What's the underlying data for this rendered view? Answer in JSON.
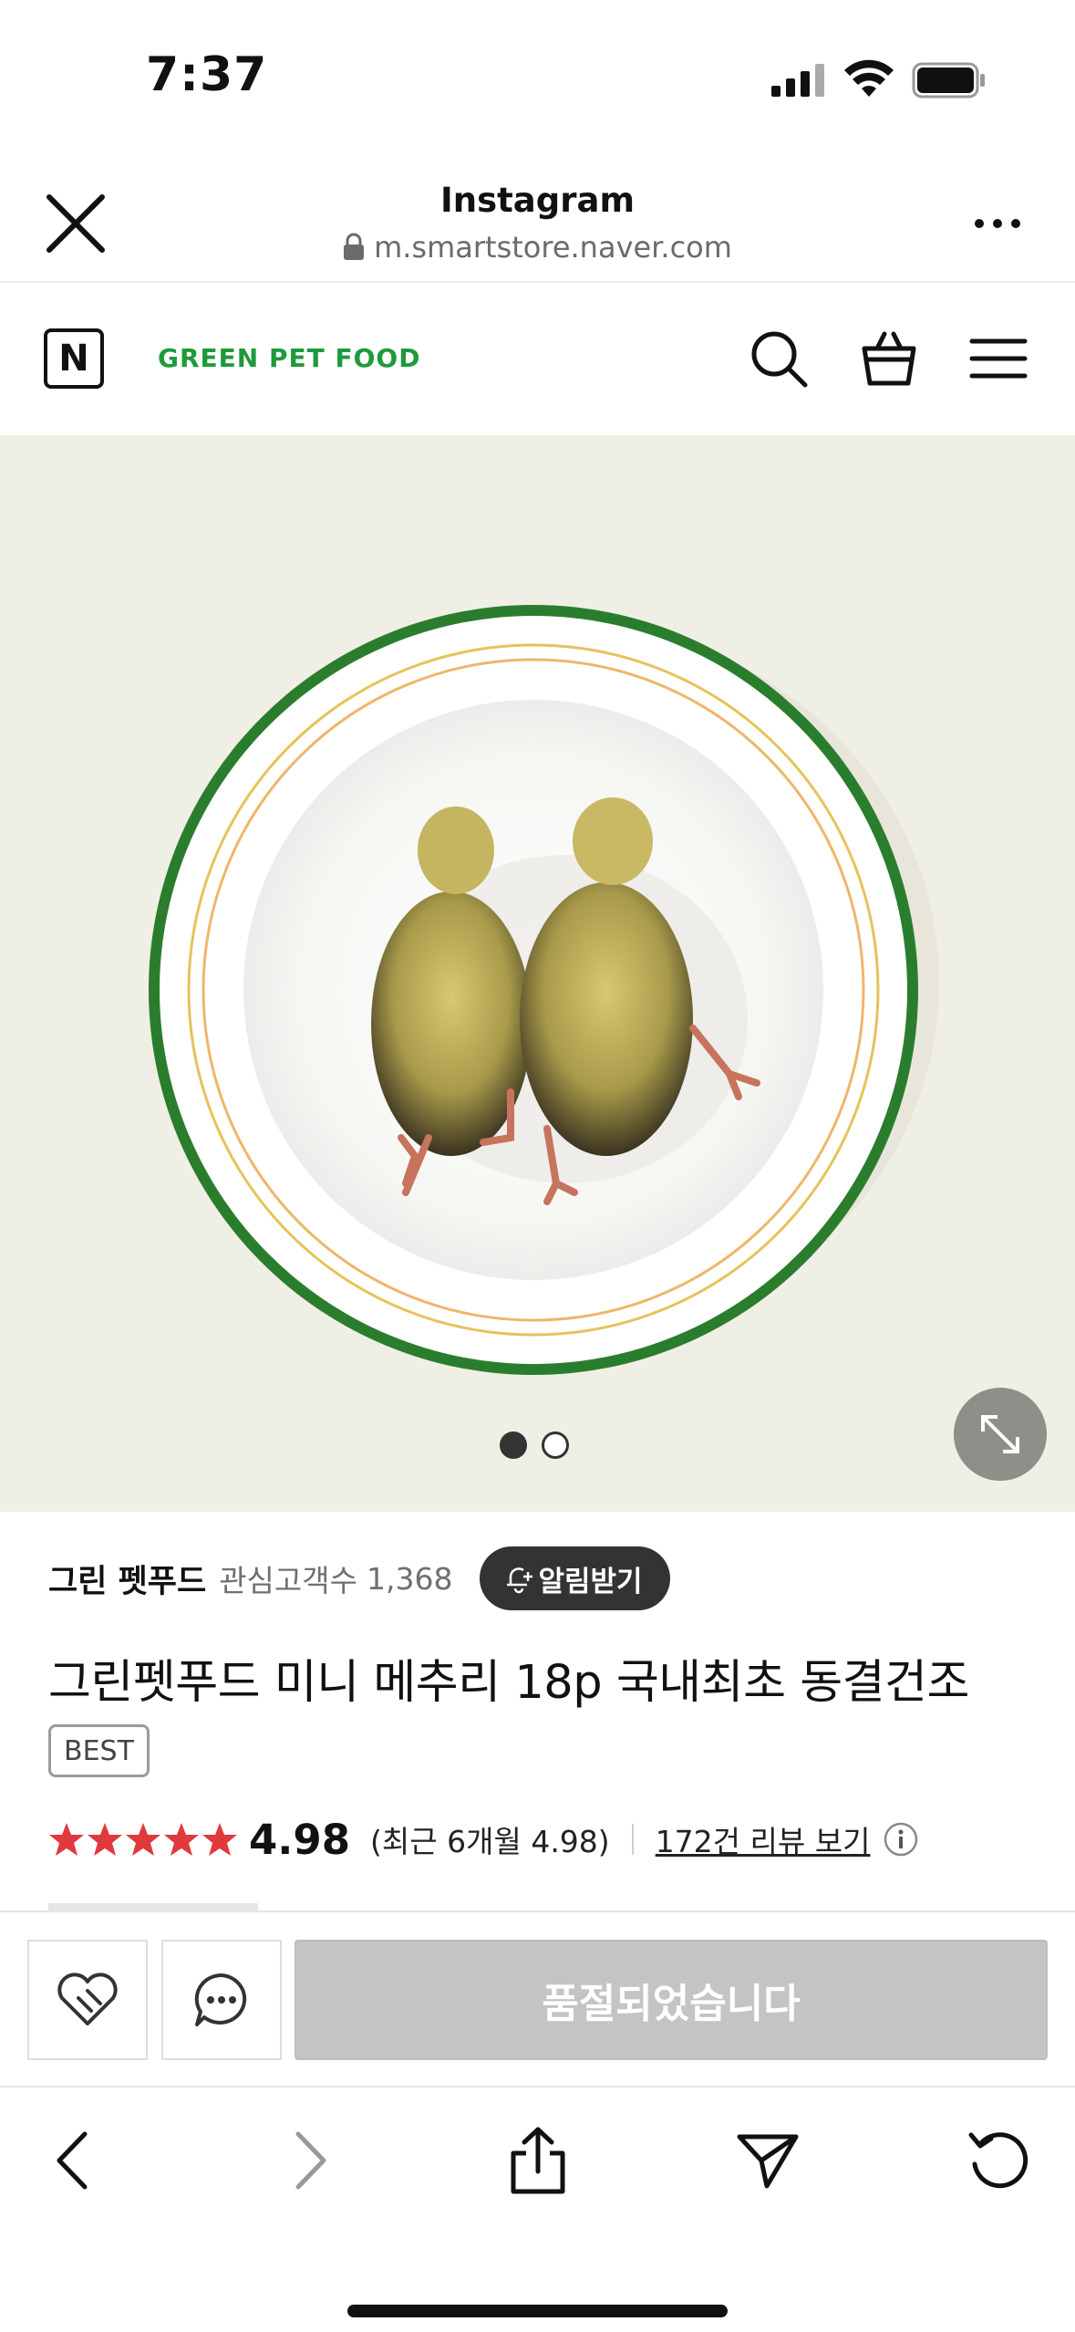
{
  "status_bar": {
    "time": "7:37",
    "icons": [
      "cellular-signal-icon",
      "wifi-icon",
      "battery-icon"
    ]
  },
  "browser_header": {
    "title": "Instagram",
    "url": "m.smartstore.naver.com",
    "icons": [
      "close-icon",
      "lock-icon",
      "more-icon"
    ]
  },
  "store_nav": {
    "logo_letter": "N",
    "store_name": "GREEN PET FOOD",
    "icons": [
      "search-icon",
      "shopping-bag-icon",
      "menu-icon"
    ]
  },
  "gallery": {
    "total_images": 2,
    "active_index": 0,
    "image_description_icon": "product-photo",
    "expand_icon": "expand-icon"
  },
  "product": {
    "seller_name": "그린 펫푸드",
    "follower_label": "관심고객수",
    "follower_count": "1,368",
    "alert_button": "알림받기",
    "title": "그린펫푸드 미니 메추리 18p 국내최초 동결건조",
    "badge": "BEST",
    "rating": "4.98",
    "star_count": 5,
    "recent_rating": "(최근 6개월 4.98)",
    "review_link": "172건 리뷰 보기"
  },
  "purchase_bar": {
    "soldout_label": "품절되었습니다",
    "icons": [
      "wishlist-heart-icon",
      "talk-chat-icon"
    ]
  },
  "toolbar": {
    "icons": [
      "back-icon",
      "forward-icon",
      "share-icon",
      "send-icon",
      "reload-icon"
    ]
  },
  "colors": {
    "brand_green": "#1e9a3a",
    "background_image": "#f0efe5",
    "star_red": "#e0393e",
    "soldout_gray": "#c4c4c4"
  }
}
